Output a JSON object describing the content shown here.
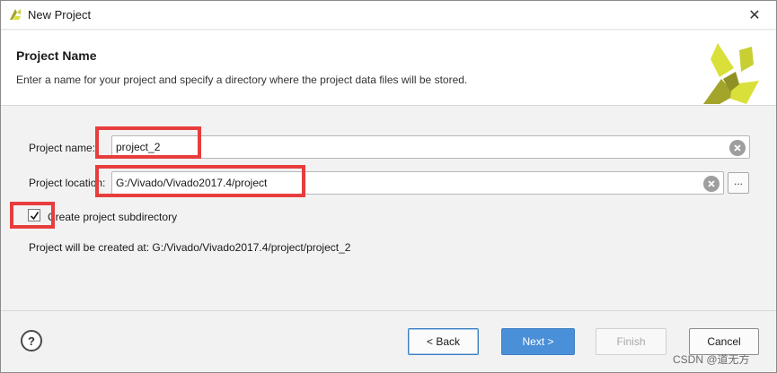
{
  "window": {
    "title": "New Project",
    "close_glyph": "✕"
  },
  "header": {
    "title": "Project Name",
    "description": "Enter a name for your project and specify a directory where the project data files will be stored."
  },
  "form": {
    "project_name_label": "Project name:",
    "project_name_value": "project_2",
    "project_location_label": "Project location:",
    "project_location_value": "G:/Vivado/Vivado2017.4/project",
    "browse_label": "...",
    "subdir_checked": true,
    "subdir_label": "Create project subdirectory",
    "created_at_text": "Project will be created at: G:/Vivado/Vivado2017.4/project/project_2"
  },
  "footer": {
    "help_label": "?",
    "back_label": "< Back",
    "next_label": "Next >",
    "finish_label": "Finish",
    "cancel_label": "Cancel"
  },
  "watermark": "CSDN @道无方",
  "colors": {
    "accent": "#4a90d9",
    "annotation": "#e83d3d",
    "logo_dark": "#a3a42a",
    "logo_light": "#d9e03a"
  }
}
